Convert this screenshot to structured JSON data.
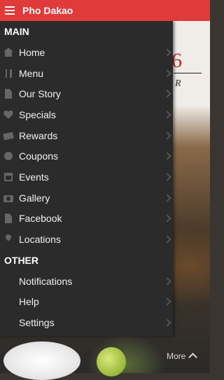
{
  "app": {
    "title": "Pho Dakao"
  },
  "drawer": {
    "main_section": "MAIN",
    "main_items": [
      {
        "label": "Home",
        "icon": "home-icon"
      },
      {
        "label": "Menu",
        "icon": "utensils-icon"
      },
      {
        "label": "Our Story",
        "icon": "document-icon"
      },
      {
        "label": "Specials",
        "icon": "heart-icon"
      },
      {
        "label": "Rewards",
        "icon": "ticket-icon"
      },
      {
        "label": "Coupons",
        "icon": "circle-icon"
      },
      {
        "label": "Events",
        "icon": "calendar-icon"
      },
      {
        "label": "Gallery",
        "icon": "camera-icon"
      },
      {
        "label": "Facebook",
        "icon": "document-icon"
      },
      {
        "label": "Locations",
        "icon": "map-pin-icon"
      }
    ],
    "other_section": "OTHER",
    "other_items": [
      {
        "label": "Notifications"
      },
      {
        "label": "Help"
      },
      {
        "label": "Settings"
      }
    ]
  },
  "background": {
    "more_label": "More"
  },
  "colors": {
    "header": "#e03a3a",
    "drawer": "#2b2b2b"
  }
}
